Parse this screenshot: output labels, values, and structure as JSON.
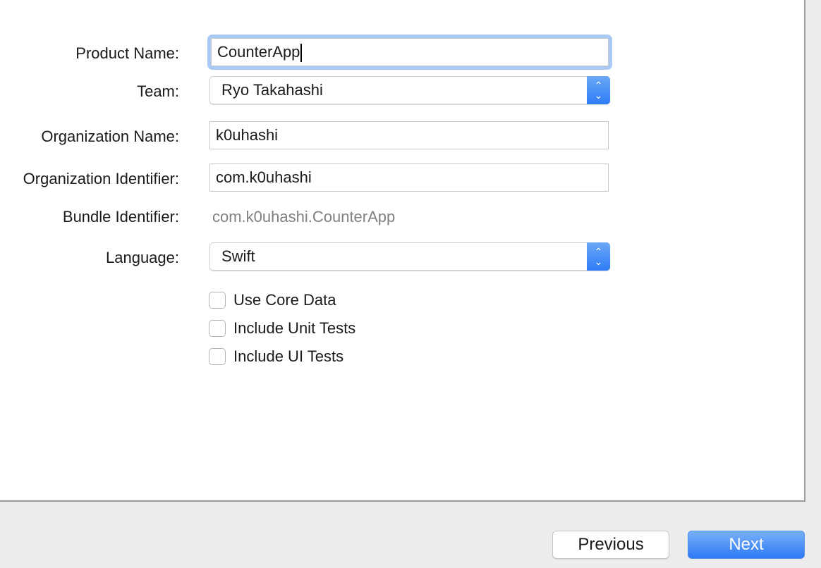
{
  "form": {
    "product_name": {
      "label": "Product Name:",
      "value": "CounterApp"
    },
    "team": {
      "label": "Team:",
      "value": "Ryo Takahashi"
    },
    "organization_name": {
      "label": "Organization Name:",
      "value": "k0uhashi"
    },
    "organization_identifier": {
      "label": "Organization Identifier:",
      "value": "com.k0uhashi"
    },
    "bundle_identifier": {
      "label": "Bundle Identifier:",
      "value": "com.k0uhashi.CounterApp"
    },
    "language": {
      "label": "Language:",
      "value": "Swift"
    },
    "checkboxes": [
      {
        "label": "Use Core Data",
        "checked": false
      },
      {
        "label": "Include Unit Tests",
        "checked": false
      },
      {
        "label": "Include UI Tests",
        "checked": false
      }
    ]
  },
  "footer": {
    "previous_label": "Previous",
    "next_label": "Next"
  },
  "colors": {
    "accent": "#2f7cf6",
    "focus_ring": "#a9c9f5"
  }
}
